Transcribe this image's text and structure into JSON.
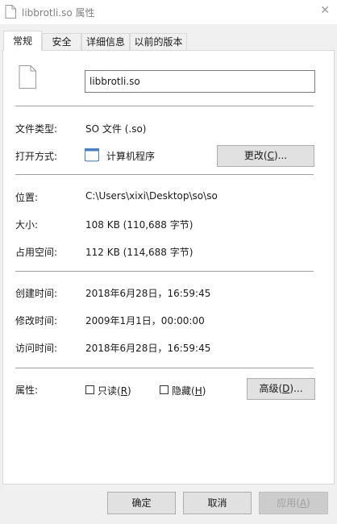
{
  "window": {
    "title": "libbrotli.so 属性"
  },
  "tabs": [
    {
      "label": "常规",
      "active": true
    },
    {
      "label": "安全",
      "active": false
    },
    {
      "label": "详细信息",
      "active": false
    },
    {
      "label": "以前的版本",
      "active": false
    }
  ],
  "general": {
    "file_name": "libbrotli.so",
    "file_type_label": "文件类型:",
    "file_type_value": "SO 文件 (.so)",
    "opens_with_label": "打开方式:",
    "opens_with_value": "计算机程序",
    "change_button": "更改(",
    "change_key": "C",
    "change_suffix": ")...",
    "location_label": "位置:",
    "location_value": "C:\\Users\\xixi\\Desktop\\so\\so",
    "size_label": "大小:",
    "size_value": "108 KB (110,688 字节)",
    "size_on_disk_label": "占用空间:",
    "size_on_disk_value": "112 KB (114,688 字节)",
    "created_label": "创建时间:",
    "created_value": "2018年6月28日，16:59:45",
    "modified_label": "修改时间:",
    "modified_value": "2009年1月1日，00:00:00",
    "accessed_label": "访问时间:",
    "accessed_value": "2018年6月28日，16:59:45",
    "attributes_label": "属性:",
    "readonly_label": "只读(",
    "readonly_key": "R",
    "readonly_suffix": ")",
    "readonly_checked": false,
    "hidden_label": "隐藏(",
    "hidden_key": "H",
    "hidden_suffix": ")",
    "hidden_checked": false,
    "advanced_button": "高级(",
    "advanced_key": "D",
    "advanced_suffix": ")..."
  },
  "footer": {
    "ok": "确定",
    "cancel": "取消",
    "apply": "应用(",
    "apply_key": "A",
    "apply_suffix": ")"
  },
  "icons": {
    "title": "document-icon",
    "file": "document-icon",
    "app": "window-app-icon"
  }
}
